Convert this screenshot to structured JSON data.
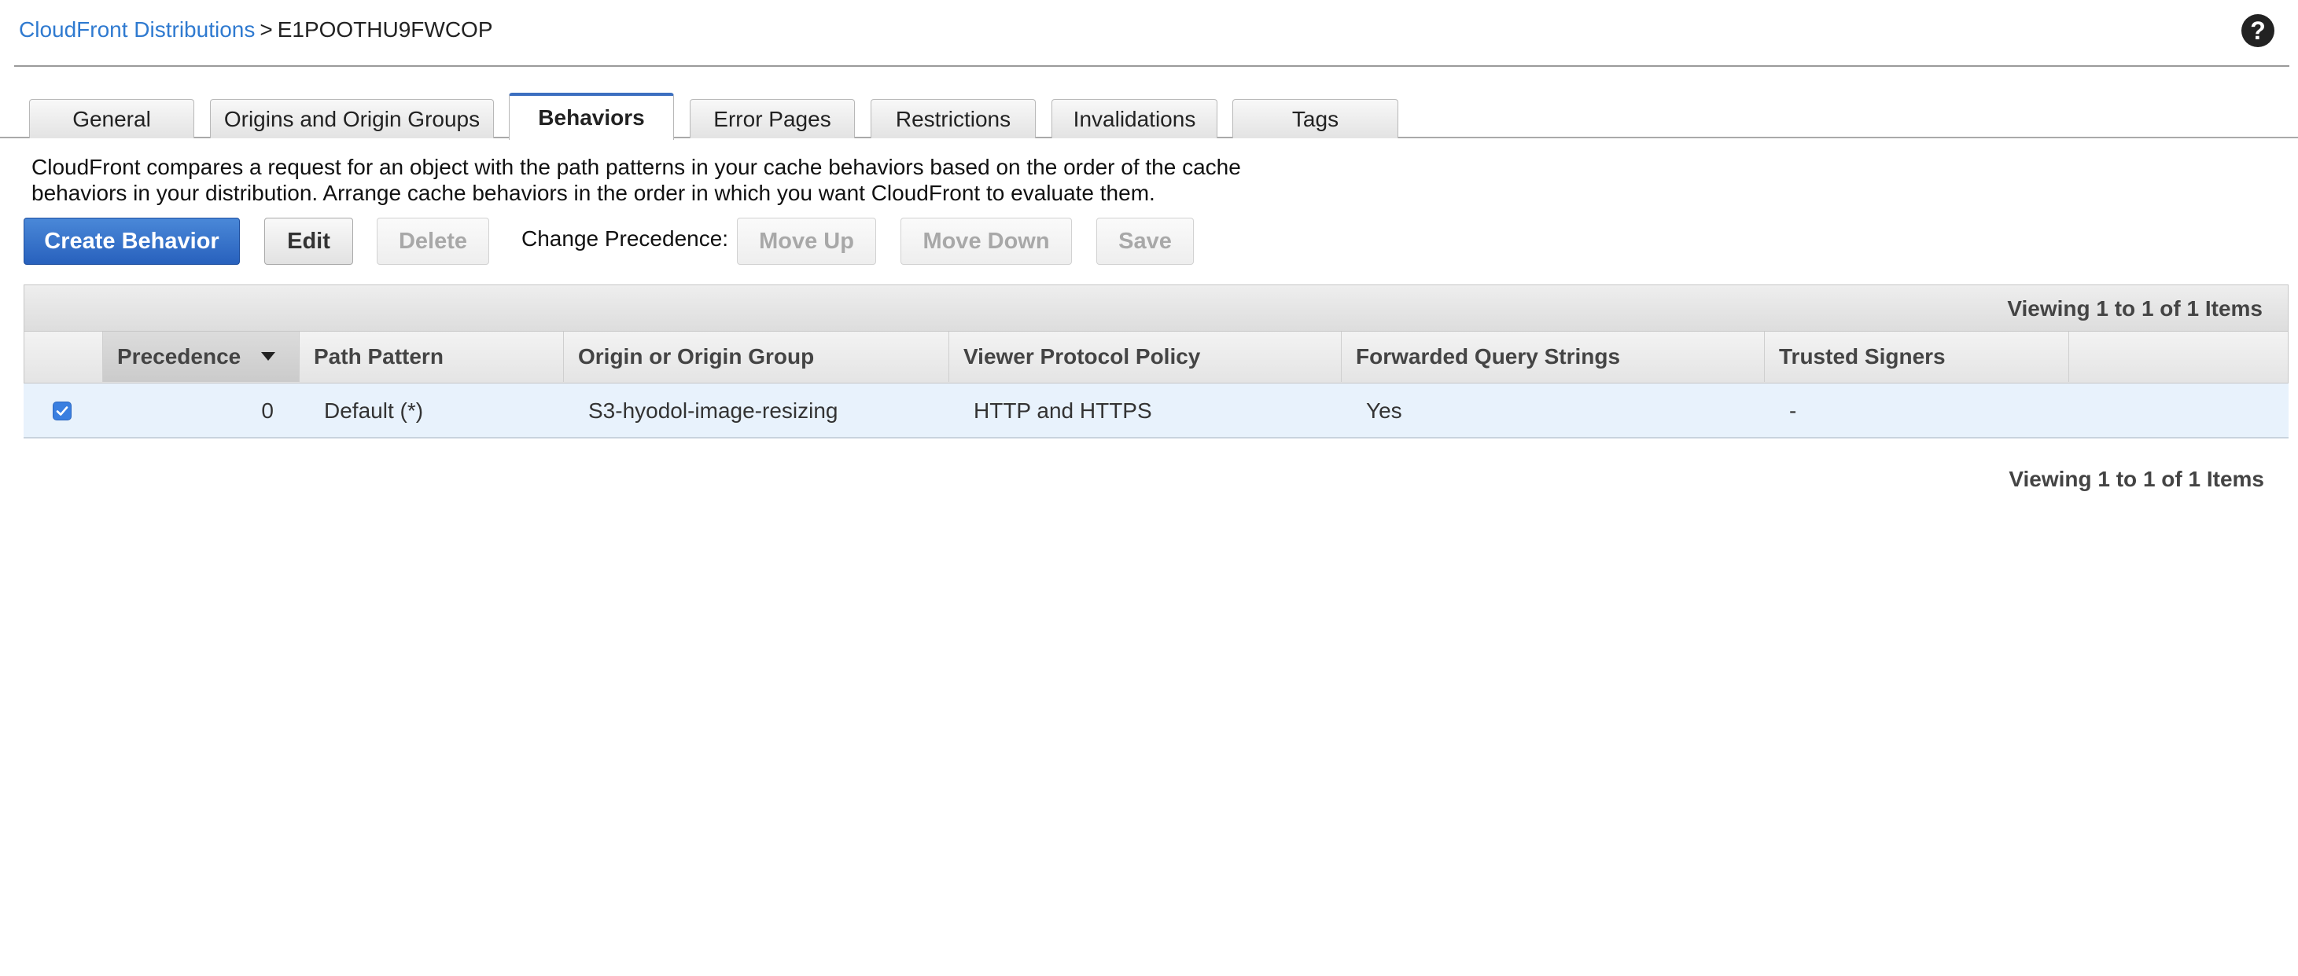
{
  "breadcrumb": {
    "parent": "CloudFront Distributions",
    "separator": ">",
    "current": "E1POOTHU9FWCOP"
  },
  "help": {
    "glyph": "?"
  },
  "tabs": [
    {
      "label": "General",
      "active": false
    },
    {
      "label": "Origins and Origin Groups",
      "active": false
    },
    {
      "label": "Behaviors",
      "active": true
    },
    {
      "label": "Error Pages",
      "active": false
    },
    {
      "label": "Restrictions",
      "active": false
    },
    {
      "label": "Invalidations",
      "active": false
    },
    {
      "label": "Tags",
      "active": false
    }
  ],
  "description": "CloudFront compares a request for an object with the path patterns in your cache behaviors based on the order of the cache behaviors in your distribution. Arrange cache behaviors in the order in which you want CloudFront to evaluate them.",
  "toolbar": {
    "create_label": "Create Behavior",
    "edit_label": "Edit",
    "delete_label": "Delete",
    "change_precedence_label": "Change Precedence:",
    "move_up_label": "Move Up",
    "move_down_label": "Move Down",
    "save_label": "Save"
  },
  "table": {
    "viewing_top": "Viewing 1 to 1 of 1 Items",
    "viewing_bottom": "Viewing 1 to 1 of 1 Items",
    "columns": [
      "Precedence",
      "Path Pattern",
      "Origin or Origin Group",
      "Viewer Protocol Policy",
      "Forwarded Query Strings",
      "Trusted Signers"
    ],
    "sorted_column": "Precedence",
    "rows": [
      {
        "selected": true,
        "precedence": "0",
        "path_pattern": "Default (*)",
        "origin": "S3-hyodol-image-resizing",
        "viewer_protocol_policy": "HTTP and HTTPS",
        "forwarded_query_strings": "Yes",
        "trusted_signers": "-"
      }
    ]
  },
  "colors": {
    "link": "#2f7ad0",
    "primary_button": "#2861bd",
    "active_tab_accent": "#3c6fc0",
    "selected_row": "#e8f2fc"
  }
}
